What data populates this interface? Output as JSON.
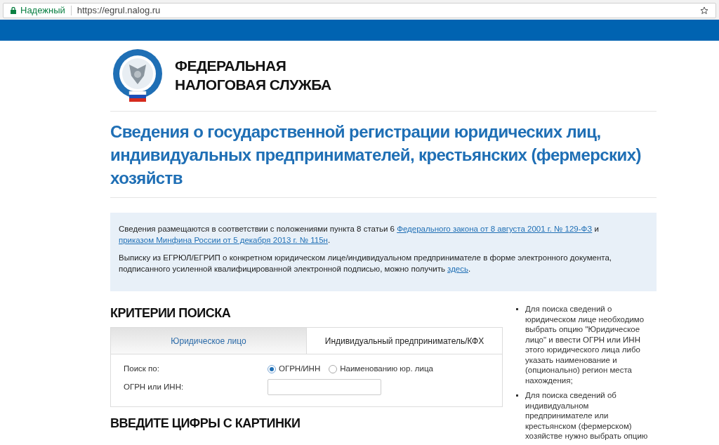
{
  "browser": {
    "security_label": "Надежный",
    "url": "https://egrul.nalog.ru"
  },
  "header": {
    "org_name_line1": "ФЕДЕРАЛЬНАЯ",
    "org_name_line2": "НАЛОГОВАЯ СЛУЖБА"
  },
  "title": "Сведения о государственной регистрации юридических лиц, индивидуальных предпринимателей, крестьянских (фермерских) хозяйств",
  "info": [
    {
      "parts": [
        {
          "kind": "text",
          "text": "Сведения размещаются в соответствии с положениями пункта 8 статьи 6 "
        },
        {
          "kind": "link",
          "text": "Федерального закона от 8 августа 2001 г. № 129-ФЗ"
        },
        {
          "kind": "text",
          "text": " и "
        },
        {
          "kind": "link",
          "text": "приказом Минфина России от 5 декабря 2013 г. № 115н"
        },
        {
          "kind": "text",
          "text": "."
        }
      ]
    },
    {
      "parts": [
        {
          "kind": "text",
          "text": "Выписку из ЕГРЮЛ/ЕГРИП о конкретном юридическом лице/индивидуальном предпринимателе в форме электронного документа, подписанного усиленной квалифицированной электронной подписью, можно получить "
        },
        {
          "kind": "link",
          "text": "здесь"
        },
        {
          "kind": "text",
          "text": "."
        }
      ]
    }
  ],
  "search": {
    "heading": "КРИТЕРИИ ПОИСКА",
    "tabs": [
      {
        "label": "Юридическое лицо",
        "selected": true
      },
      {
        "label": "Индивидуальный предприниматель/КФХ",
        "selected": false
      }
    ],
    "search_by_label": "Поиск по:",
    "options": [
      {
        "label": "ОГРН/ИНН",
        "selected": true
      },
      {
        "label": "Наименованию юр. лица",
        "selected": false
      }
    ],
    "field_label": "ОГРН или ИНН:"
  },
  "captcha_heading": "ВВЕДИТЕ ЦИФРЫ С КАРТИНКИ",
  "help": [
    "Для поиска сведений о юридическом лице необходимо выбрать опцию \"Юридическое лицо\" и ввести ОГРН или ИНН этого юридического лица либо указать наименование и (опционально) регион места нахождения;",
    "Для поиска сведений об индивидуальном предпринимателе или крестьянском (фермерском) хозяйстве нужно выбрать опцию"
  ]
}
